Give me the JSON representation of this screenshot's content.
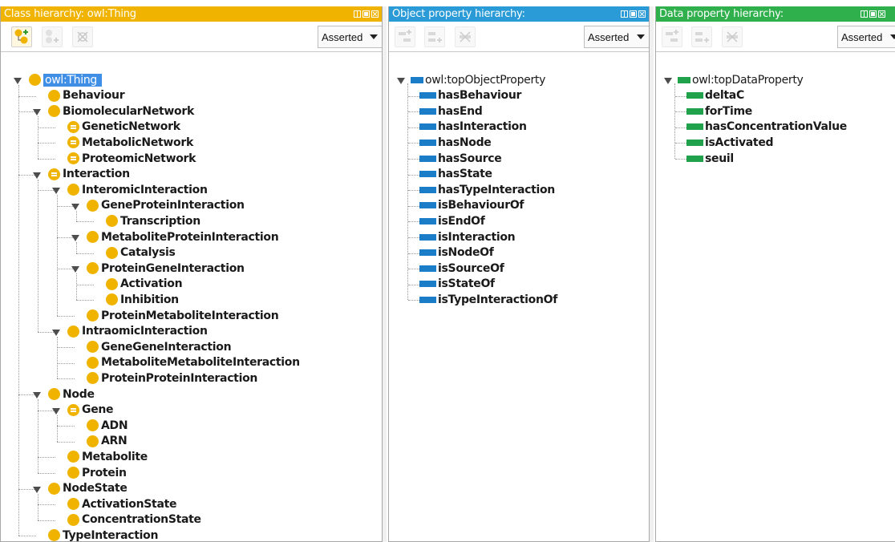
{
  "colors": {
    "class_panel": "#efb300",
    "object_panel": "#2a9bd7",
    "data_panel": "#2fb04c",
    "class_dot": "#f0b400",
    "object_bar": "#1b7cc7",
    "data_bar": "#1fa24b",
    "selection": "#3f8fe6"
  },
  "class_panel": {
    "title": "Class hierarchy: owl:Thing",
    "mode": "Asserted",
    "toolbar_icons": [
      "add-subclass-icon",
      "add-sibling-icon",
      "delete-class-icon"
    ],
    "nodes": [
      {
        "label": "owl:Thing",
        "depth": 0,
        "expanded": true,
        "selected": true,
        "eq": false
      },
      {
        "label": "Behaviour",
        "depth": 1,
        "expanded": null,
        "eq": false
      },
      {
        "label": "BiomolecularNetwork",
        "depth": 1,
        "expanded": true,
        "eq": false
      },
      {
        "label": "GeneticNetwork",
        "depth": 2,
        "expanded": null,
        "eq": true
      },
      {
        "label": "MetabolicNetwork",
        "depth": 2,
        "expanded": null,
        "eq": true
      },
      {
        "label": "ProteomicNetwork",
        "depth": 2,
        "expanded": null,
        "eq": true
      },
      {
        "label": "Interaction",
        "depth": 1,
        "expanded": true,
        "eq": true
      },
      {
        "label": "InteromicInteraction",
        "depth": 2,
        "expanded": true,
        "eq": false
      },
      {
        "label": "GeneProteinInteraction",
        "depth": 3,
        "expanded": true,
        "eq": false
      },
      {
        "label": "Transcription",
        "depth": 4,
        "expanded": null,
        "eq": false
      },
      {
        "label": "MetaboliteProteinInteraction",
        "depth": 3,
        "expanded": true,
        "eq": false
      },
      {
        "label": "Catalysis",
        "depth": 4,
        "expanded": null,
        "eq": false
      },
      {
        "label": "ProteinGeneInteraction",
        "depth": 3,
        "expanded": true,
        "eq": false
      },
      {
        "label": "Activation",
        "depth": 4,
        "expanded": null,
        "eq": false
      },
      {
        "label": "Inhibition",
        "depth": 4,
        "expanded": null,
        "eq": false
      },
      {
        "label": "ProteinMetaboliteInteraction",
        "depth": 3,
        "expanded": null,
        "eq": false
      },
      {
        "label": "IntraomicInteraction",
        "depth": 2,
        "expanded": true,
        "eq": false
      },
      {
        "label": "GeneGeneInteraction",
        "depth": 3,
        "expanded": null,
        "eq": false
      },
      {
        "label": "MetaboliteMetaboliteInteraction",
        "depth": 3,
        "expanded": null,
        "eq": false
      },
      {
        "label": "ProteinProteinInteraction",
        "depth": 3,
        "expanded": null,
        "eq": false
      },
      {
        "label": "Node",
        "depth": 1,
        "expanded": true,
        "eq": false
      },
      {
        "label": "Gene",
        "depth": 2,
        "expanded": true,
        "eq": true
      },
      {
        "label": "ADN",
        "depth": 3,
        "expanded": null,
        "eq": false
      },
      {
        "label": "ARN",
        "depth": 3,
        "expanded": null,
        "eq": false
      },
      {
        "label": "Metabolite",
        "depth": 2,
        "expanded": null,
        "eq": false
      },
      {
        "label": "Protein",
        "depth": 2,
        "expanded": null,
        "eq": false
      },
      {
        "label": "NodeState",
        "depth": 1,
        "expanded": true,
        "eq": false
      },
      {
        "label": "ActivationState",
        "depth": 2,
        "expanded": null,
        "eq": false
      },
      {
        "label": "ConcentrationState",
        "depth": 2,
        "expanded": null,
        "eq": false
      },
      {
        "label": "TypeInteraction",
        "depth": 1,
        "expanded": null,
        "eq": false
      }
    ]
  },
  "object_panel": {
    "title": "Object property hierarchy:",
    "mode": "Asserted",
    "toolbar_icons": [
      "add-sub-property-icon",
      "add-sibling-property-icon",
      "delete-property-icon"
    ],
    "root": "owl:topObjectProperty",
    "items": [
      "hasBehaviour",
      "hasEnd",
      "hasInteraction",
      "hasNode",
      "hasSource",
      "hasState",
      "hasTypeInteraction",
      "isBehaviourOf",
      "isEndOf",
      "isInteraction",
      "isNodeOf",
      "isSourceOf",
      "isStateOf",
      "isTypeInteractionOf"
    ]
  },
  "data_panel": {
    "title": "Data property hierarchy:",
    "mode": "Asserted",
    "toolbar_icons": [
      "add-sub-property-icon",
      "add-sibling-property-icon",
      "delete-property-icon"
    ],
    "root": "owl:topDataProperty",
    "items": [
      "deltaC",
      "forTime",
      "hasConcentrationValue",
      "isActivated",
      "seuil"
    ]
  }
}
